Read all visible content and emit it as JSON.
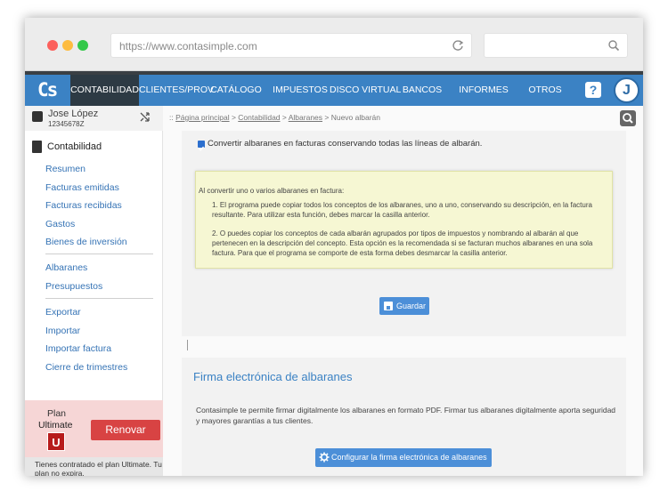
{
  "browser": {
    "url": "https://www.contasimple.com",
    "search_placeholder": ""
  },
  "nav": {
    "logo": "Cs",
    "items": [
      "CONTABILIDAD",
      "CLIENTES/PROV.",
      "CATÁLOGO",
      "IMPUESTOS",
      "DISCO VIRTUAL",
      "BANCOS",
      "INFORMES",
      "OTROS"
    ],
    "help_label": "?",
    "avatar_initial": "J"
  },
  "sidebar": {
    "user_name": "Jose López",
    "user_id": "12345678Z",
    "section_title": "Contabilidad",
    "group1": [
      "Resumen",
      "Facturas emitidas",
      "Facturas recibidas",
      "Gastos",
      "Bienes de inversión"
    ],
    "group2": [
      "Albaranes",
      "Presupuestos"
    ],
    "group3": [
      "Exportar",
      "Importar",
      "Importar factura",
      "Cierre de trimestres"
    ],
    "plan": {
      "label": "Plan",
      "name": "Ultimate",
      "badge": "U",
      "renew_label": "Renovar",
      "info": "Tienes contratado el plan Ultimate. Tu plan no expira."
    }
  },
  "breadcrumb": {
    "prefix": ":: ",
    "items": [
      "Página principal",
      "Contabilidad",
      "Albaranes"
    ],
    "current": "Nuevo albarán"
  },
  "convert_panel": {
    "checkbox_label": "Convertir albaranes en facturas conservando todas las líneas de albarán.",
    "checked": true,
    "intro": "Al convertir uno o varios albaranes en factura:",
    "item1": "1. El programa puede copiar todos los conceptos de los albaranes, uno a uno, conservando su descripción, en la factura resultante. Para utilizar esta función, debes marcar la casilla anterior.",
    "item2": "2. O puedes copiar los conceptos de cada albarán agrupados por tipos de impuestos y nombrando al albarán al que pertenecen en la descripción del concepto. Esta opción es la recomendada si se facturan muchos albaranes en una sola factura. Para que el programa se comporte de esta forma debes desmarcar la casilla anterior.",
    "save_label": "Guardar"
  },
  "signature_panel": {
    "title": "Firma electrónica de albaranes",
    "text": "Contasimple te permite firmar digitalmente los albaranes en formato PDF. Firmar tus albaranes digitalmente aporta seguridad y mayores garantías a tus clientes.",
    "button_label": "Configurar la firma electrónica de albaranes"
  },
  "colors": {
    "nav_blue": "#3b82c4",
    "nav_active": "#2d3a44",
    "link_blue": "#3573b5",
    "info_yellow": "#f6f7d3",
    "renew_red": "#d84343"
  }
}
